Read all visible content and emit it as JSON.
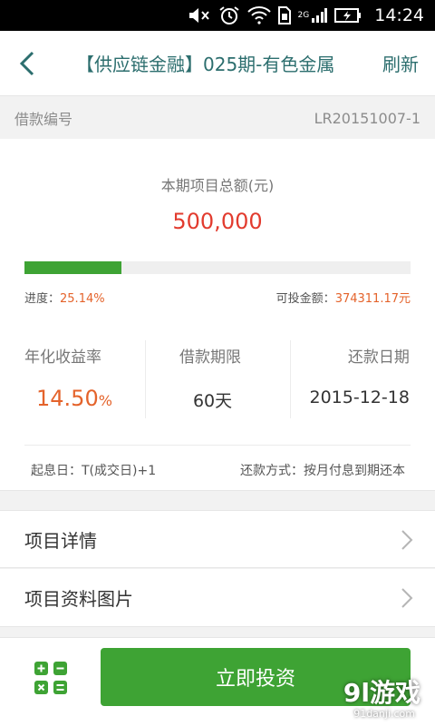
{
  "status_bar": {
    "network": "2G",
    "time": "14:24"
  },
  "nav": {
    "title": "【供应链金融】025期-有色金属",
    "refresh": "刷新"
  },
  "loan": {
    "label": "借款编号",
    "value": "LR20151007-1"
  },
  "summary": {
    "total_label": "本期项目总额(元)",
    "total_amount": "500,000",
    "progress_fraction": 0.2514,
    "progress_label": "进度：",
    "progress_value": "25.14%",
    "available_label": "可投金额：",
    "available_value": "374311.17元"
  },
  "stats": {
    "rate_label": "年化收益率",
    "rate_value": "14.50",
    "rate_unit": "%",
    "term_label": "借款期限",
    "term_value": "60天",
    "repay_date_label": "还款日期",
    "repay_date_value": "2015-12-18"
  },
  "terms": {
    "start_label": "起息日：",
    "start_value": "T(成交日)+1",
    "method_label": "还款方式：",
    "method_value": "按月付息到期还本"
  },
  "list": {
    "details": "项目详情",
    "images": "项目资料图片"
  },
  "footer": {
    "invest_button": "立即投资"
  },
  "watermark": {
    "logo": "9l游戏",
    "url": "91danji.com"
  },
  "colors": {
    "accent_green": "#3ea334",
    "title_teal": "#2c6e6e",
    "amount_red": "#e23b2e",
    "orange": "#e4632b"
  }
}
